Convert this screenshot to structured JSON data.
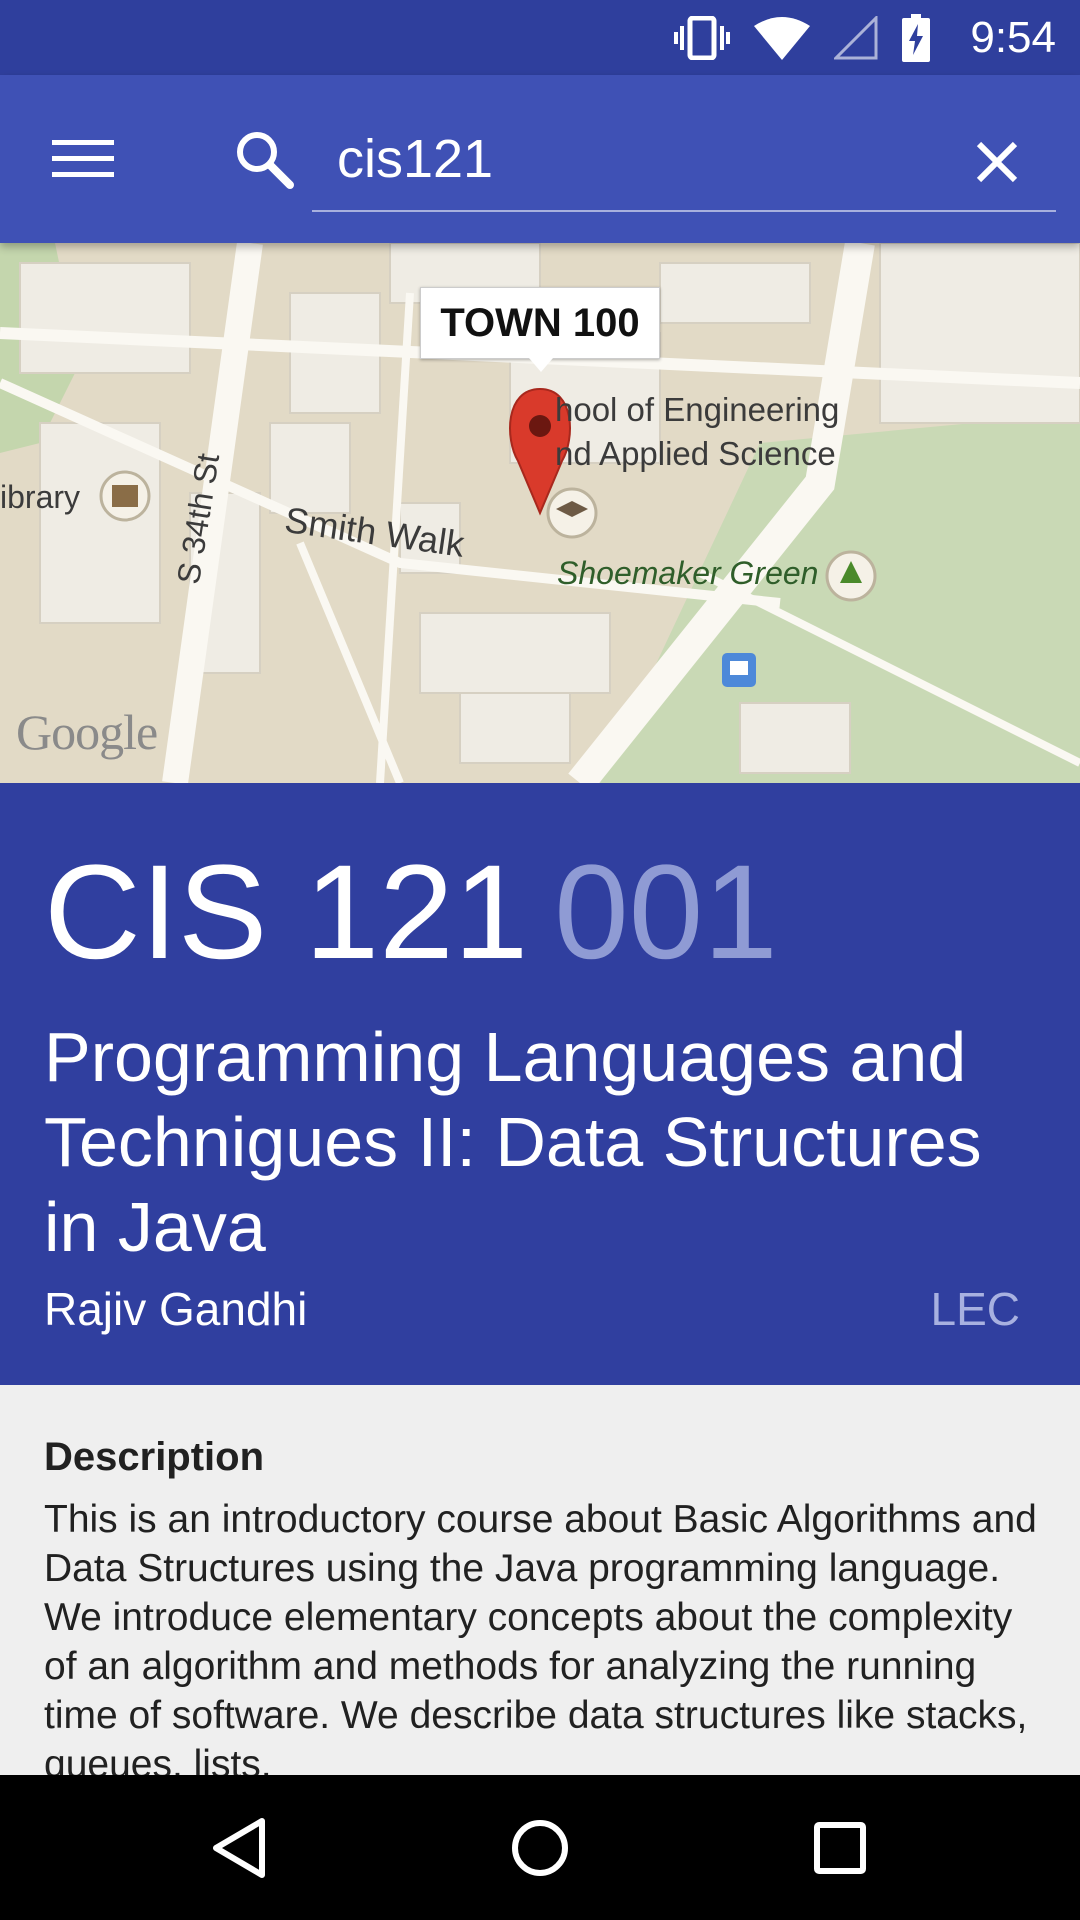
{
  "status_bar": {
    "time": "9:54",
    "icons": [
      "vibrate-icon",
      "wifi-icon",
      "signal-icon",
      "battery-charging-icon"
    ]
  },
  "app_bar": {
    "menu_icon": "hamburger-menu-icon",
    "search_icon": "search-icon",
    "search_value": "cis121",
    "clear_icon": "close-icon"
  },
  "map": {
    "callout": "TOWN 100",
    "labels": {
      "school_line1": "hool of Engineering",
      "school_line2": "nd Applied Science",
      "library": "ibrary",
      "street_34th": "S 34th St",
      "smith_walk": "Smith Walk",
      "shoemaker_green": "Shoemaker Green"
    },
    "attribution": "Google"
  },
  "course": {
    "code": "CIS 121",
    "section": "001",
    "title": "Programming Languages and Technigues II: Data Structures in Java",
    "instructor": "Rajiv Gandhi",
    "type": "LEC"
  },
  "description": {
    "heading": "Description",
    "body": "This is an introductory course about Basic Algorithms and Data Structures using the Java programming language. We introduce elementary concepts about the complexity of an algorithm and methods for analyzing the running time of software. We describe data structures like stacks, queues, lists,"
  },
  "nav_bar": {
    "buttons": [
      "back-icon",
      "home-icon",
      "recents-icon"
    ]
  },
  "colors": {
    "status_bar": "#2f3f9d",
    "app_bar": "#3f51b5",
    "course_header": "#303f9f",
    "section_text": "#8f9bd4",
    "content_bg": "#efefef"
  }
}
